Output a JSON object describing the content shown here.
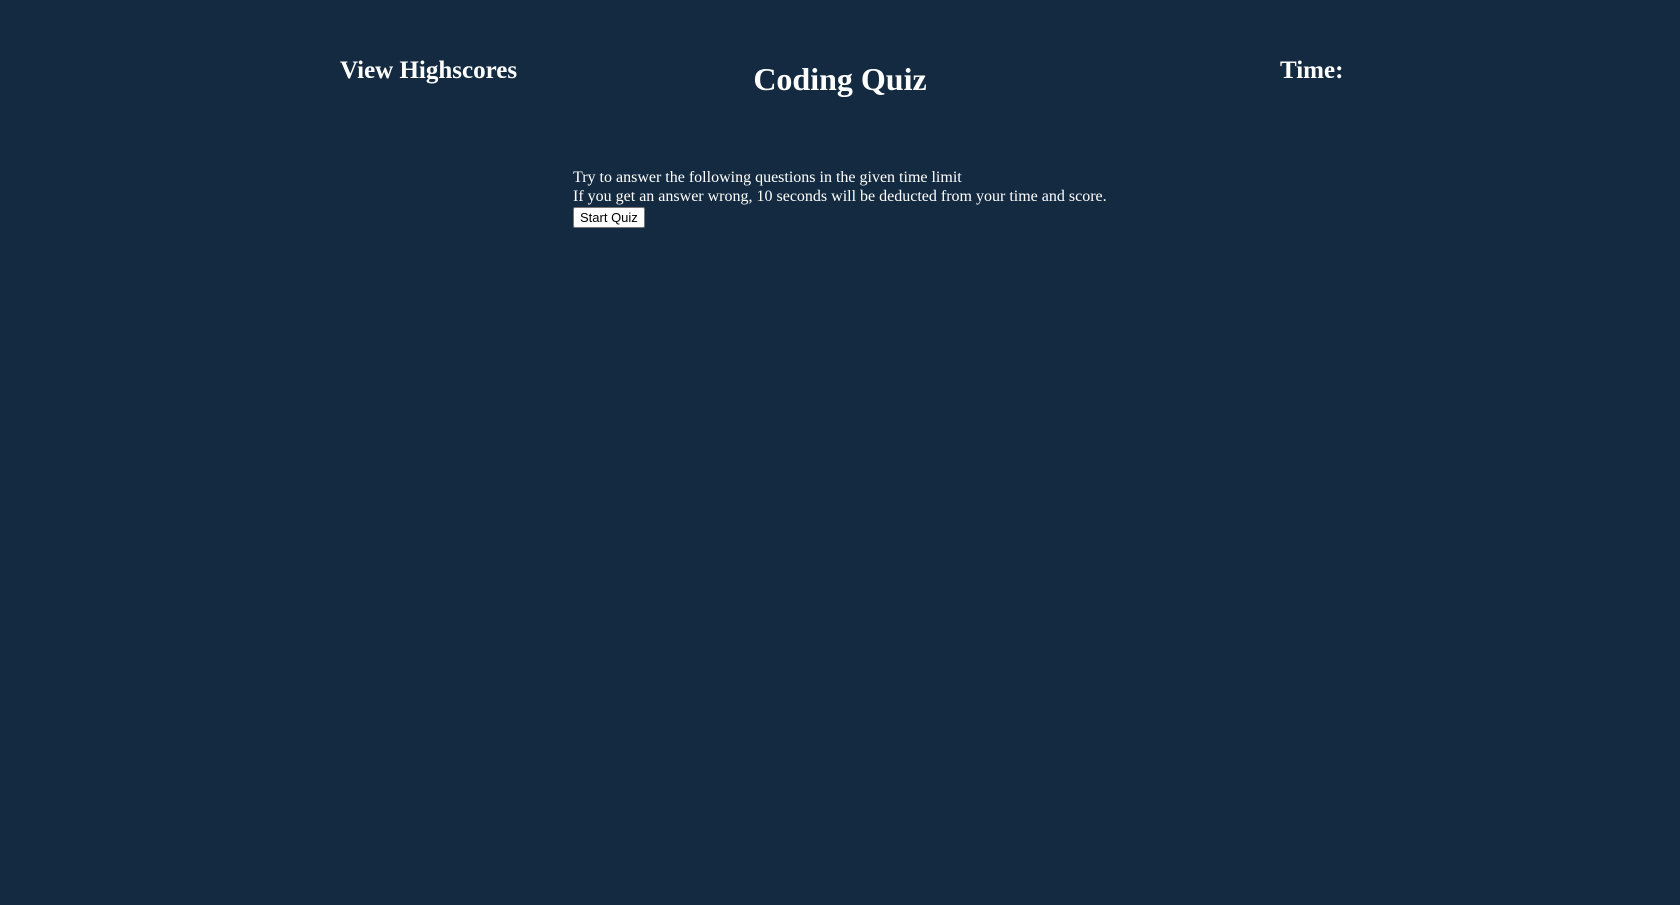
{
  "header": {
    "highscores_link": "View Highscores",
    "title": "Coding Quiz",
    "timer_label": "Time:"
  },
  "intro": {
    "line1": "Try to answer the following questions in the given time limit",
    "line2": "If you get an answer wrong, 10 seconds will be deducted from your time and score."
  },
  "buttons": {
    "start_label": "Start Quiz"
  },
  "colors": {
    "background": "#132a40",
    "text": "#ffffff"
  }
}
